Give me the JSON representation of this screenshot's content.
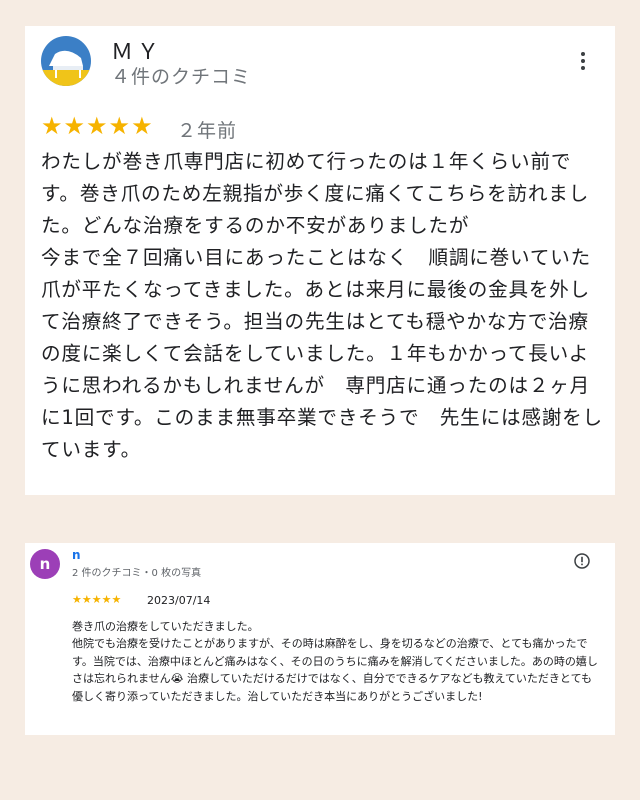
{
  "review1": {
    "reviewer_name": "ＭＹ",
    "reviewer_meta": "４件のクチコミ",
    "stars": "★★★★★",
    "rating": 5,
    "date": "２年前",
    "text": "わたしが巻き爪専門店に初めて行ったのは１年くらい前です。巻き爪のため左親指が歩く度に痛くてこちらを訪れました。どんな治療をするのか不安がありましたが\n今まで全７回痛い目にあったことはなく　順調に巻いていた爪が平たくなってきました。あとは来月に最後の金具を外して治療終了できそう。担当の先生はとても穏やかな方で治療の度に楽しくて会話をしていました。１年もかかって長いように思われるかもしれませんが　専門店に通ったのは２ヶ月に1回です。このまま無事卒業できそうで　先生には感謝をしています。"
  },
  "review2": {
    "avatar_letter": "n",
    "reviewer_name": "n",
    "reviewer_meta": "2 件のクチコミ・0 枚の写真",
    "stars": "★★★★★",
    "rating": 5,
    "date": "2023/07/14",
    "text": "巻き爪の治療をしていただきました。\n他院でも治療を受けたことがありますが、その時は麻酔をし、身を切るなどの治療で、とても痛かったです。当院では、治療中ほとんど痛みはなく、その日のうちに痛みを解消してくださいました。あの時の嬉しさは忘れられません😭 治療していただけるだけではなく、自分でできるケアなども教えていただきとても優しく寄り添っていただきました。治していただき本当にありがとうございました!"
  },
  "colors": {
    "page_background": "#f6ece3",
    "star": "#f6b300",
    "avatar2": "#9c3fb7",
    "reviewer2_name": "#1a73e8"
  },
  "icons": {
    "menu": "more-vert-icon",
    "report": "report-flag-icon"
  }
}
